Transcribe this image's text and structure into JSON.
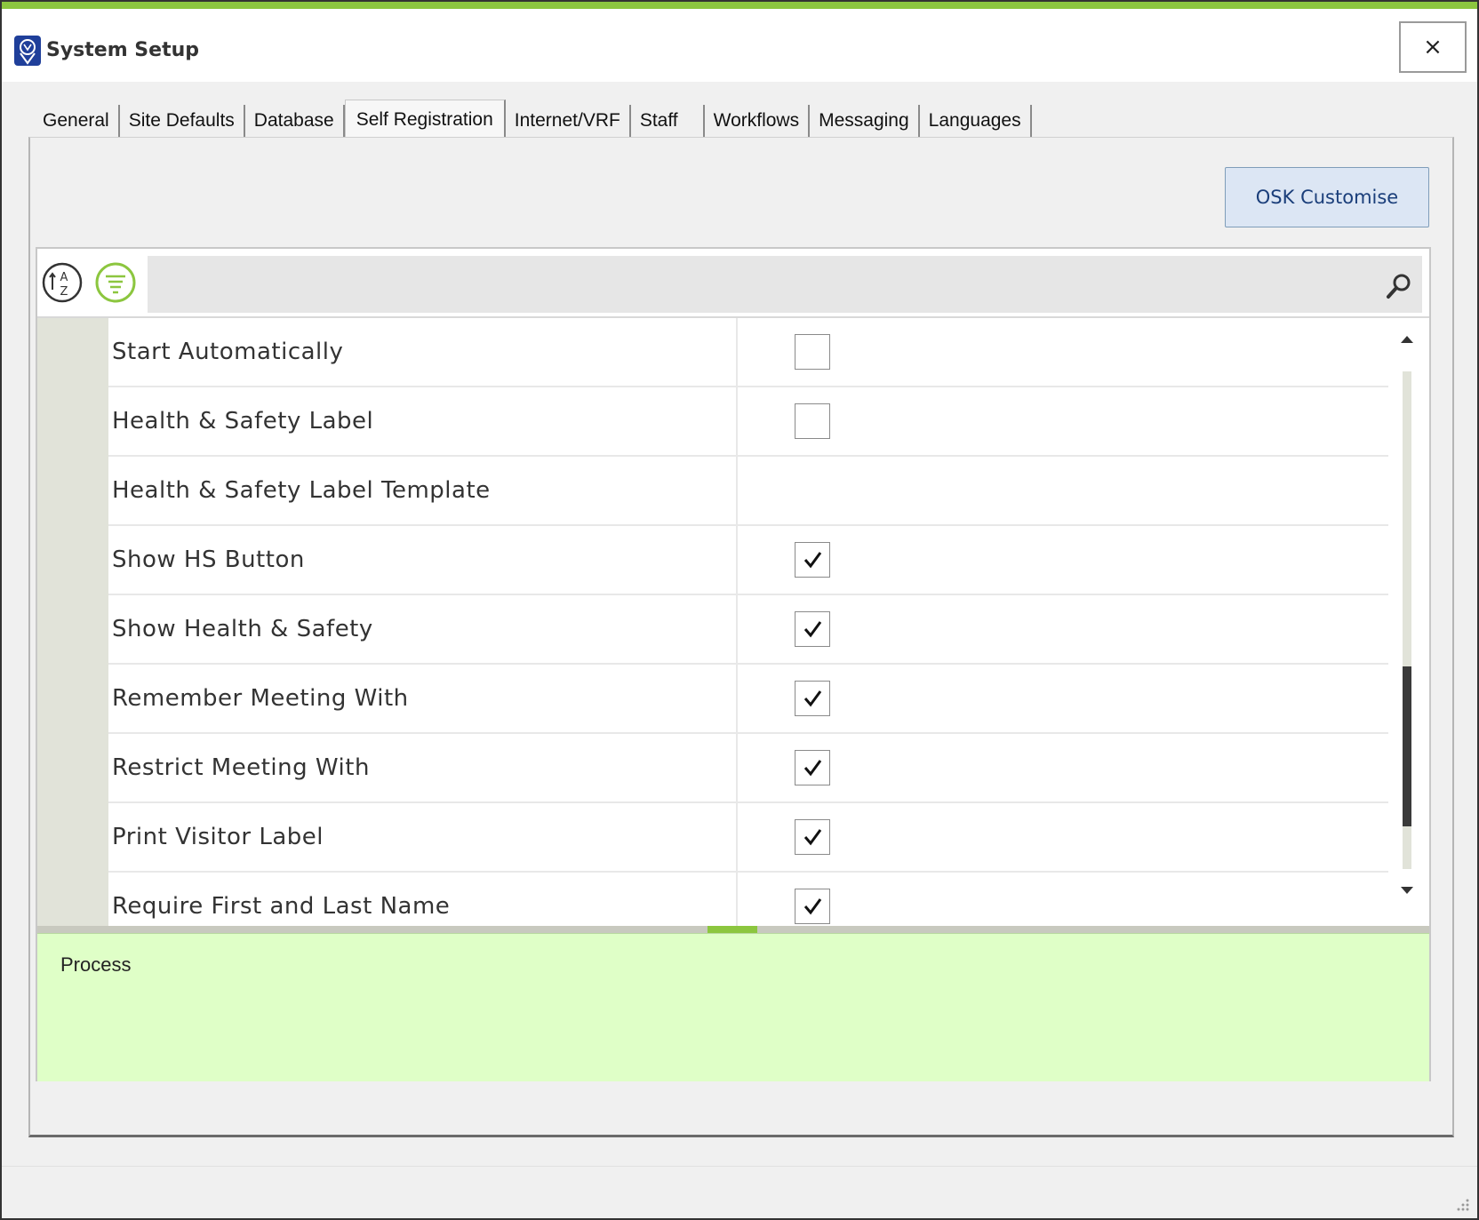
{
  "window": {
    "title": "System Setup",
    "close_glyph": "×",
    "accent_color": "#8cc63f",
    "icon": "app-logo-icon"
  },
  "tabs": [
    {
      "label": "General",
      "active": false
    },
    {
      "label": "Site Defaults",
      "active": false
    },
    {
      "label": "Database",
      "active": false
    },
    {
      "label": "Self Registration",
      "active": true
    },
    {
      "label": "Internet/VRF",
      "active": false
    },
    {
      "label": "Staff",
      "active": false
    },
    {
      "label": "Workflows",
      "active": false
    },
    {
      "label": "Messaging",
      "active": false
    },
    {
      "label": "Languages",
      "active": false
    }
  ],
  "toolbar": {
    "osk_button_label": "OSK Customise",
    "sort_icon": "sort-alphabetical-icon",
    "categorize_icon": "categorized-icon",
    "search_icon": "search-icon",
    "search_value": ""
  },
  "properties": [
    {
      "name": "Start Automatically",
      "value": "unchecked"
    },
    {
      "name": "Health & Safety Label",
      "value": "unchecked"
    },
    {
      "name": "Health & Safety Label Template",
      "value": ""
    },
    {
      "name": "Show HS Button",
      "value": "checked"
    },
    {
      "name": "Show Health & Safety",
      "value": "checked"
    },
    {
      "name": "Remember Meeting With",
      "value": "checked"
    },
    {
      "name": "Restrict Meeting With",
      "value": "checked"
    },
    {
      "name": "Print Visitor Label",
      "value": "checked"
    },
    {
      "name": "Require First and Last Name",
      "value": "checked"
    }
  ],
  "description": {
    "title": "Process",
    "background": "#dfffc7"
  }
}
